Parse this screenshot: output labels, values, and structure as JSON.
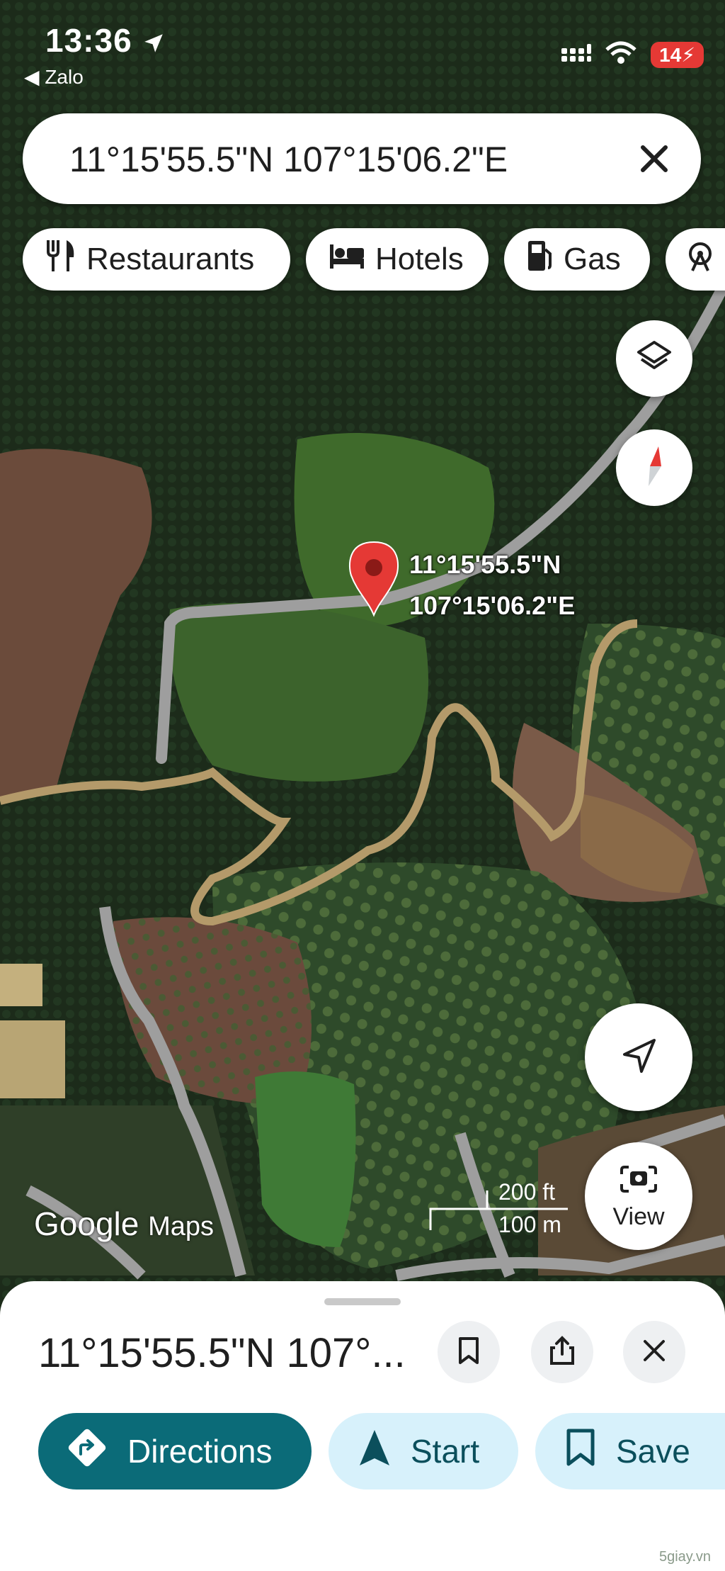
{
  "status_bar": {
    "time": "13:36",
    "back_app": "◀ Zalo",
    "battery": "14",
    "icons": [
      "location-arrow-icon",
      "signal-icon",
      "wifi-icon",
      "battery-icon"
    ]
  },
  "search": {
    "query": "11°15'55.5\"N 107°15'06.2\"E",
    "icons": [
      "close-icon"
    ]
  },
  "chips": [
    {
      "label": "Restaurants",
      "icon": "fork-knife-icon"
    },
    {
      "label": "Hotels",
      "icon": "bed-icon"
    },
    {
      "label": "Gas",
      "icon": "gas-pump-icon"
    },
    {
      "label": "",
      "icon": "attraction-icon"
    }
  ],
  "map": {
    "pin_label_lat": "11°15'55.5\"N",
    "pin_label_lng": "107°15'06.2\"E",
    "scale_ft": "200 ft",
    "scale_m": "100 m",
    "logo_google": "Google",
    "logo_maps": "Maps",
    "controls": [
      "layers-icon",
      "compass-icon",
      "my-location-icon",
      "view-camera-icon"
    ],
    "view_label": "View"
  },
  "sheet": {
    "title": "11°15'55.5\"N 107°...",
    "buttons": [
      "bookmark-icon",
      "share-icon",
      "close-icon"
    ],
    "actions": [
      {
        "label": "Directions",
        "icon": "directions-icon"
      },
      {
        "label": "Start",
        "icon": "navigation-arrow-icon"
      },
      {
        "label": "Save",
        "icon": "bookmark-icon"
      }
    ]
  },
  "watermark": "5giay.vn",
  "colors": {
    "directions_bg": "#0b6b78",
    "action_light_bg": "#d7f1fb",
    "action_text": "#0b4f5c",
    "pin": "#e53935",
    "road": "#9e9e9e"
  }
}
